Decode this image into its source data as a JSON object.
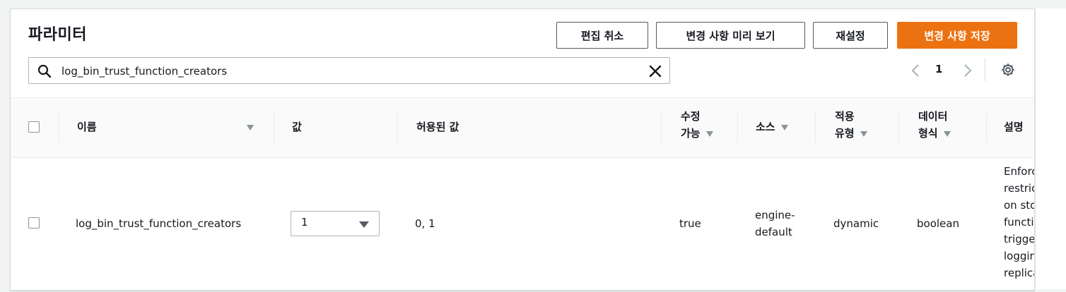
{
  "header": {
    "title": "파라미터",
    "buttons": {
      "cancel_edit": "편집 취소",
      "preview_changes": "변경 사항 미리 보기",
      "reset": "재설정",
      "save_changes": "변경 사항 저장"
    }
  },
  "search": {
    "value": "log_bin_trust_function_creators",
    "icon": "search-icon",
    "clear_icon": "close-icon"
  },
  "pagination": {
    "current_page": "1"
  },
  "table": {
    "columns": [
      {
        "key": "name",
        "label": "이름"
      },
      {
        "key": "value",
        "label": "값"
      },
      {
        "key": "allowed_values",
        "label": "허용된 값"
      },
      {
        "key": "modifiable",
        "label_line1": "수정",
        "label_line2": "가능"
      },
      {
        "key": "source",
        "label": "소스"
      },
      {
        "key": "apply_type",
        "label_line1": "적용",
        "label_line2": "유형"
      },
      {
        "key": "data_type",
        "label_line1": "데이터",
        "label_line2": "형식"
      },
      {
        "key": "description",
        "label": "설명"
      }
    ],
    "rows": [
      {
        "name": "log_bin_trust_function_creators",
        "value": "1",
        "allowed_values": "0, 1",
        "modifiable": "true",
        "source_line1": "engine-",
        "source_line2": "default",
        "apply_type": "dynamic",
        "data_type": "boolean",
        "description_lines": [
          "Enforces",
          "restrictions",
          "on stored",
          "functions /",
          "triggers -",
          "logging for",
          "replication."
        ]
      }
    ]
  },
  "colors": {
    "primary": "#ec7211",
    "border": "#545b64",
    "background": "#f2f3f3"
  }
}
